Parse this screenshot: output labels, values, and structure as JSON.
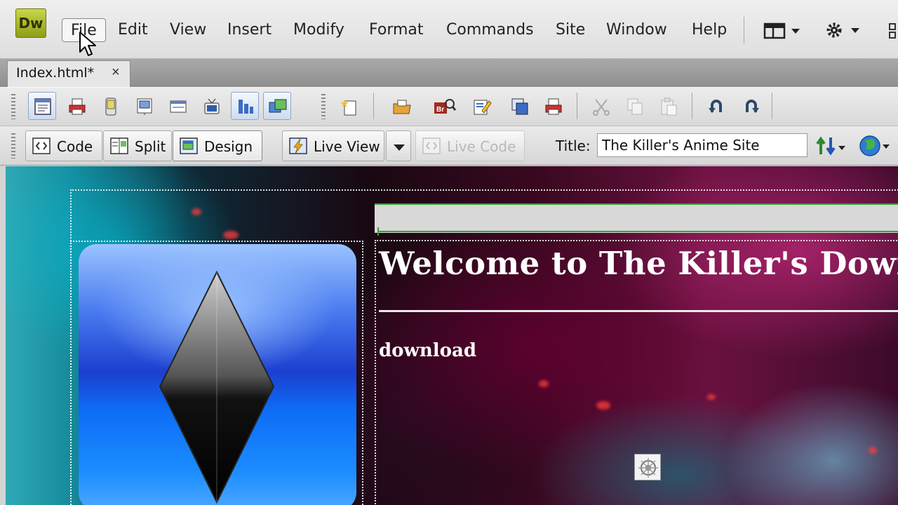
{
  "app": {
    "logo_text": "Dw",
    "menu": [
      "File",
      "Edit",
      "View",
      "Insert",
      "Modify",
      "Format",
      "Commands",
      "Site",
      "Window",
      "Help"
    ]
  },
  "document": {
    "tab_label": "Index.html*",
    "close_glyph": "×"
  },
  "doc_toolbar": {
    "code_label": "Code",
    "split_label": "Split",
    "design_label": "Design",
    "live_view_label": "Live View",
    "live_code_label": "Live Code",
    "title_label": "Title:",
    "title_value": "The Killer's Anime Site"
  },
  "insert_toolbar": {
    "icons": [
      "page-layout-icon",
      "print-icon",
      "mobile-icon",
      "template-icon",
      "form-icon",
      "media-icon",
      "chart-icon",
      "image-gallery-icon",
      "new-document-icon",
      "open-folder-icon",
      "bridge-icon",
      "edit-icon",
      "duplicate-icon",
      "print2-icon",
      "cut-icon",
      "copy-icon",
      "paste-icon",
      "undo-icon",
      "redo-icon"
    ]
  },
  "design_view": {
    "heading": "Welcome to The Killer's Down",
    "subtext": "download"
  },
  "colors": {
    "accent_green": "#34a134",
    "logo_green": "#9fae1f"
  }
}
